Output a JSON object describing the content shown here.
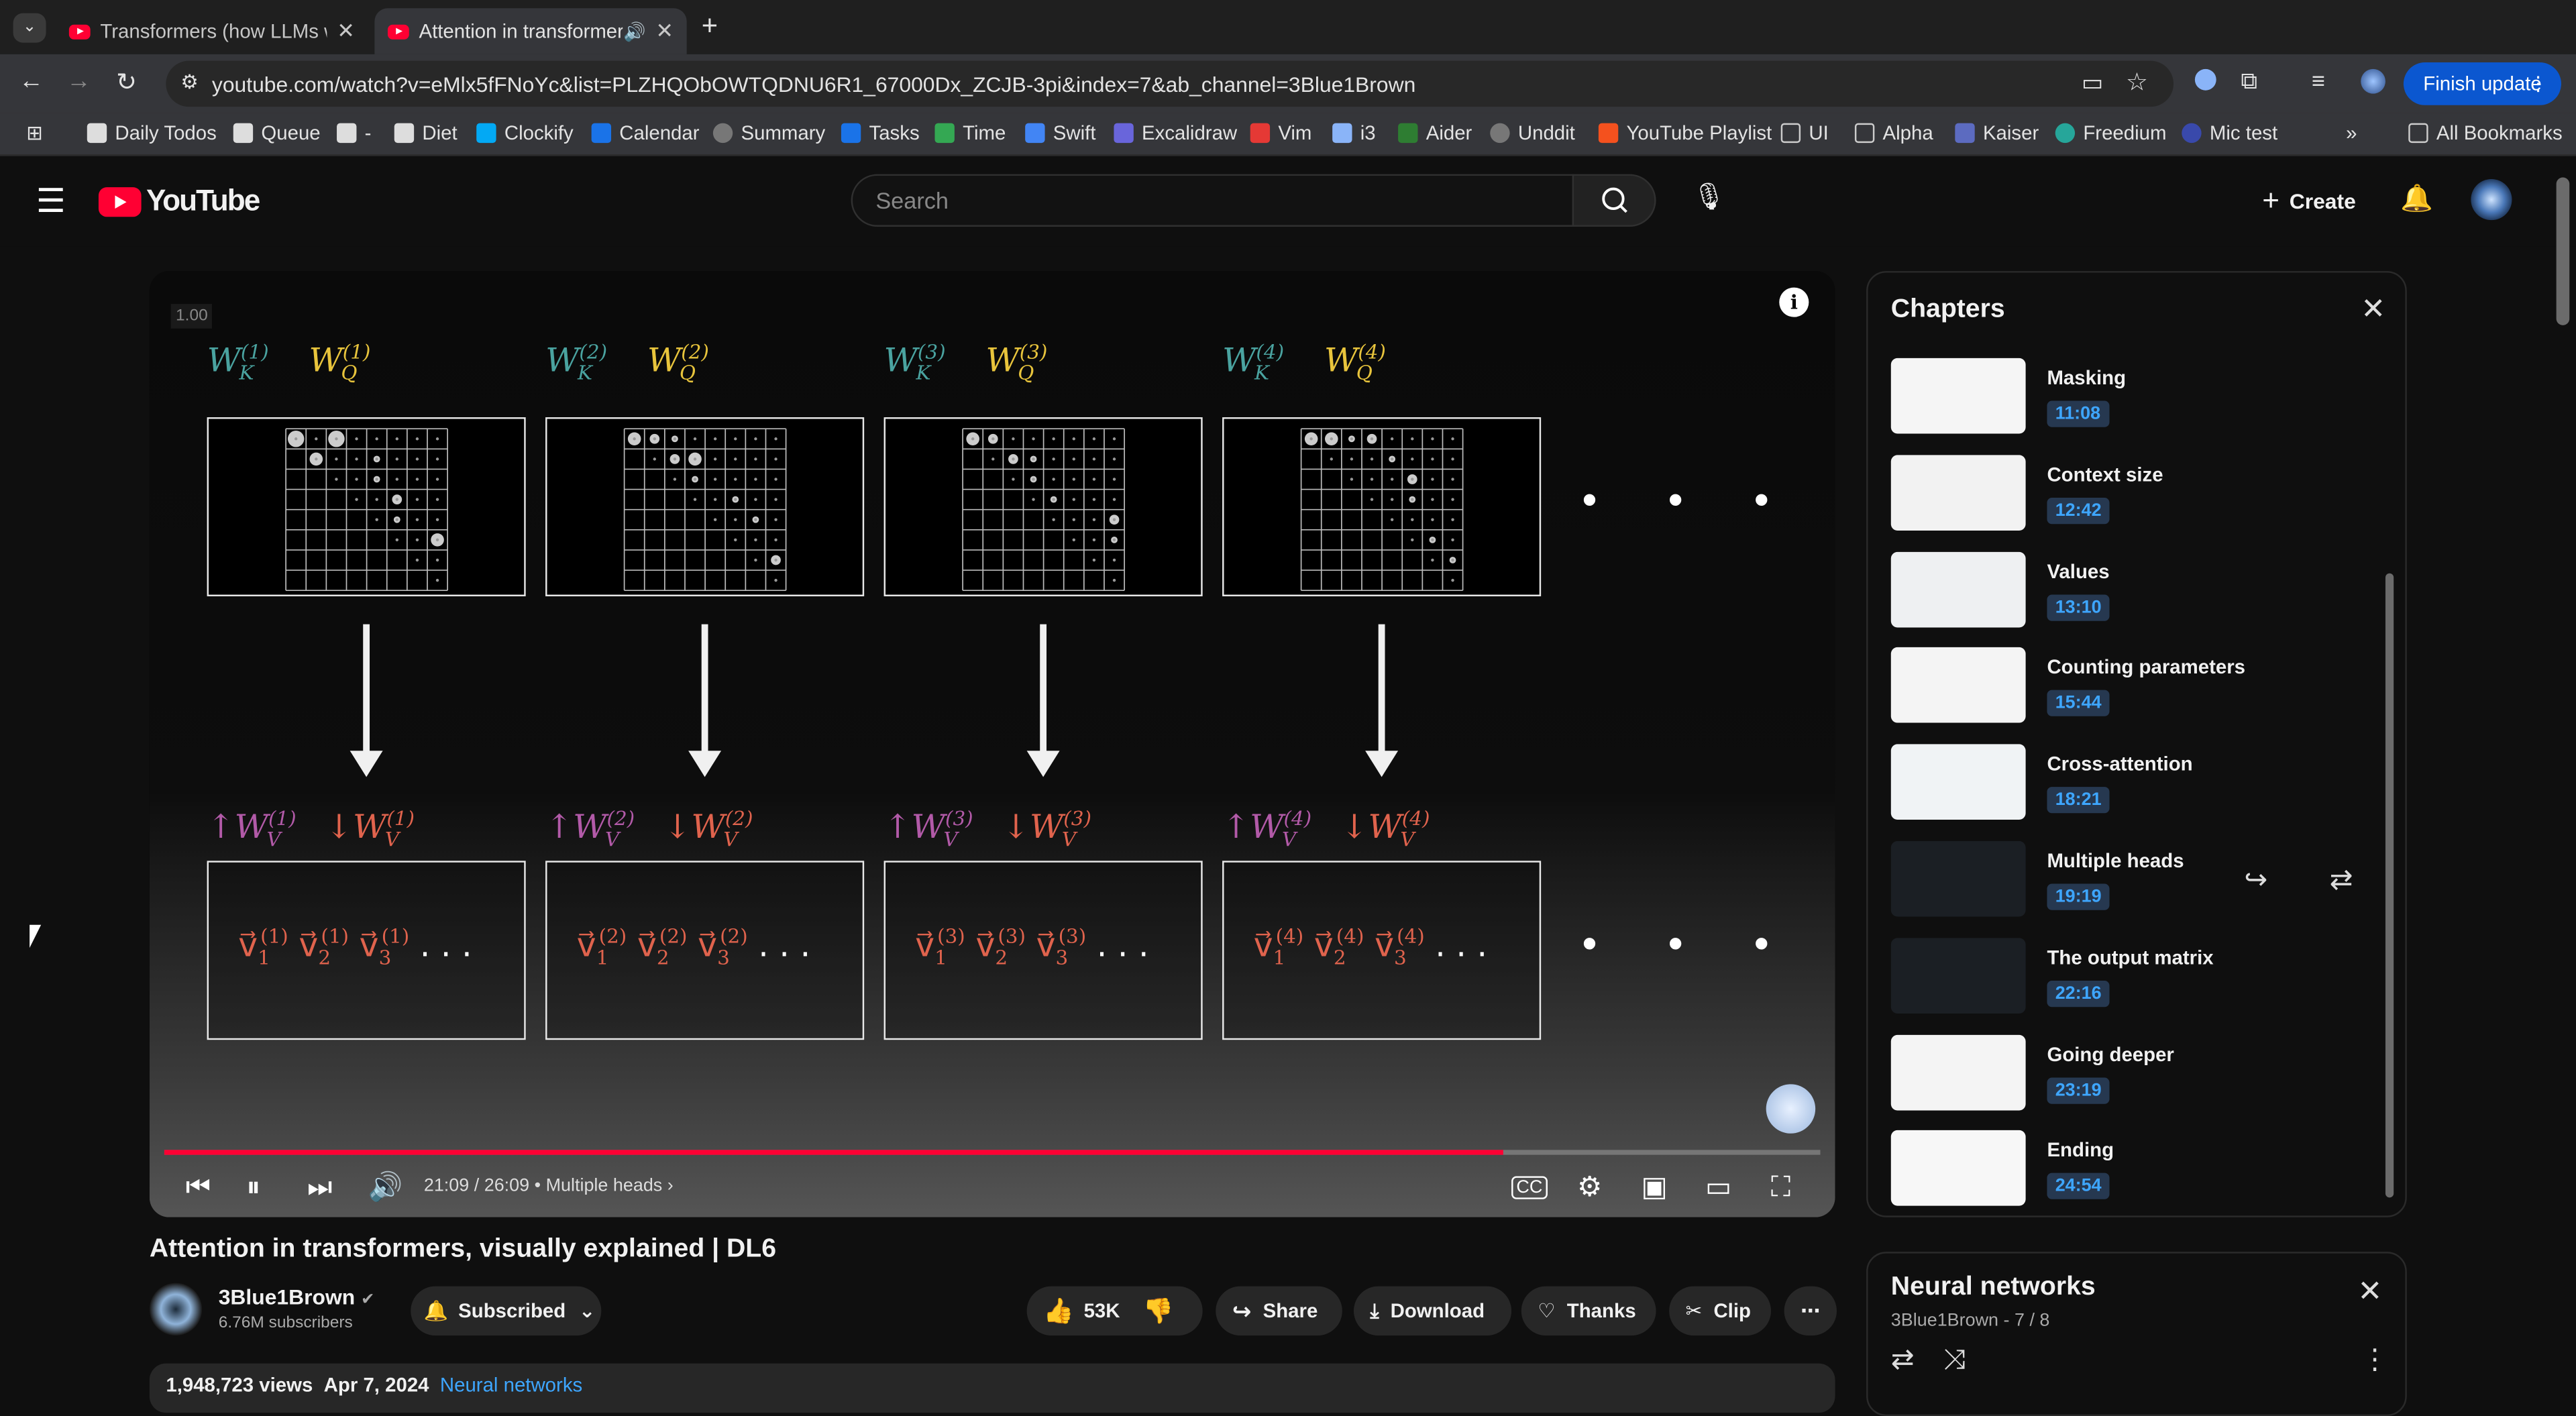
{
  "browser": {
    "tabs": [
      {
        "title": "Transformers (how LLMs w"
      },
      {
        "title": "Attention in transformer"
      }
    ],
    "url": "youtube.com/watch?v=eMlx5fFNoYc&list=PLZHQObOWTQDNU6R1_67000Dx_ZCJB-3pi&index=7&ab_channel=3Blue1Brown",
    "finish_update": "Finish update",
    "bookmarks": [
      "Daily Todos",
      "Queue",
      "-",
      "Diet",
      "Clockify",
      "Calendar",
      "Summary",
      "Tasks",
      "Time",
      "Swift",
      "Excalidraw",
      "Vim",
      "i3",
      "Aider",
      "Unddit",
      "YouTube Playlist",
      "UI",
      "Alpha",
      "Kaiser",
      "Freedium",
      "Mic test"
    ],
    "all_bookmarks": "All Bookmarks",
    "colors": {
      "accent": "#0b57d0"
    }
  },
  "youtube": {
    "logo": "YouTube",
    "search_placeholder": "Search",
    "create": "Create"
  },
  "video": {
    "zoom_badge": "1.00",
    "heads": [
      {
        "k": "(1)",
        "q": "(1)",
        "v": "(1)"
      },
      {
        "k": "(2)",
        "q": "(2)",
        "v": "(2)"
      },
      {
        "k": "(3)",
        "q": "(3)",
        "v": "(3)"
      },
      {
        "k": "(4)",
        "q": "(4)",
        "v": "(4)"
      }
    ],
    "time": "21:09 / 26:09",
    "chapter_label": "Multiple heads",
    "progress": 0.809,
    "title": "Attention in transformers, visually explained | DL6",
    "channel": "3Blue1Brown",
    "subscribers": "6.76M subscribers",
    "subscribed": "Subscribed",
    "likes": "53K",
    "share": "Share",
    "download": "Download",
    "thanks": "Thanks",
    "clip": "Clip",
    "views": "1,948,723 views",
    "date": "Apr 7, 2024",
    "tag": "Neural networks"
  },
  "chapters": {
    "title": "Chapters",
    "items": [
      {
        "name": "Masking",
        "time": "11:08"
      },
      {
        "name": "Context size",
        "time": "12:42"
      },
      {
        "name": "Values",
        "time": "13:10"
      },
      {
        "name": "Counting parameters",
        "time": "15:44"
      },
      {
        "name": "Cross-attention",
        "time": "18:21"
      },
      {
        "name": "Multiple heads",
        "time": "19:19"
      },
      {
        "name": "The output matrix",
        "time": "22:16"
      },
      {
        "name": "Going deeper",
        "time": "23:19"
      },
      {
        "name": "Ending",
        "time": "24:54"
      }
    ]
  },
  "playlist": {
    "title": "Neural networks",
    "meta": "3Blue1Brown - 7 / 8"
  }
}
